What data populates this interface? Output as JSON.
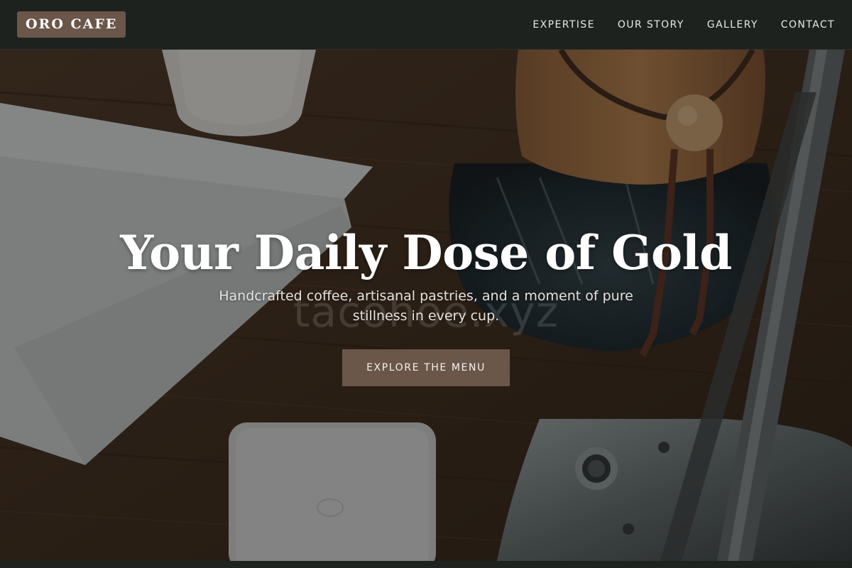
{
  "brand": {
    "logo_text": "ORO CAFE"
  },
  "nav": {
    "items": [
      {
        "label": "EXPERTISE"
      },
      {
        "label": "OUR STORY"
      },
      {
        "label": "GALLERY"
      },
      {
        "label": "CONTACT"
      }
    ]
  },
  "hero": {
    "title": "Your Daily Dose of Gold",
    "subtitle": "Handcrafted coffee, artisanal pastries, and a moment of pure stillness in every cup.",
    "cta_label": "EXPLORE THE MENU",
    "watermark_text": "tacohoe.xyz",
    "background_icon": "coffee-scene-image"
  },
  "colors": {
    "navbar_bg": "#1e221f",
    "accent_brown": "#6b564a",
    "text_white": "#ffffff"
  }
}
